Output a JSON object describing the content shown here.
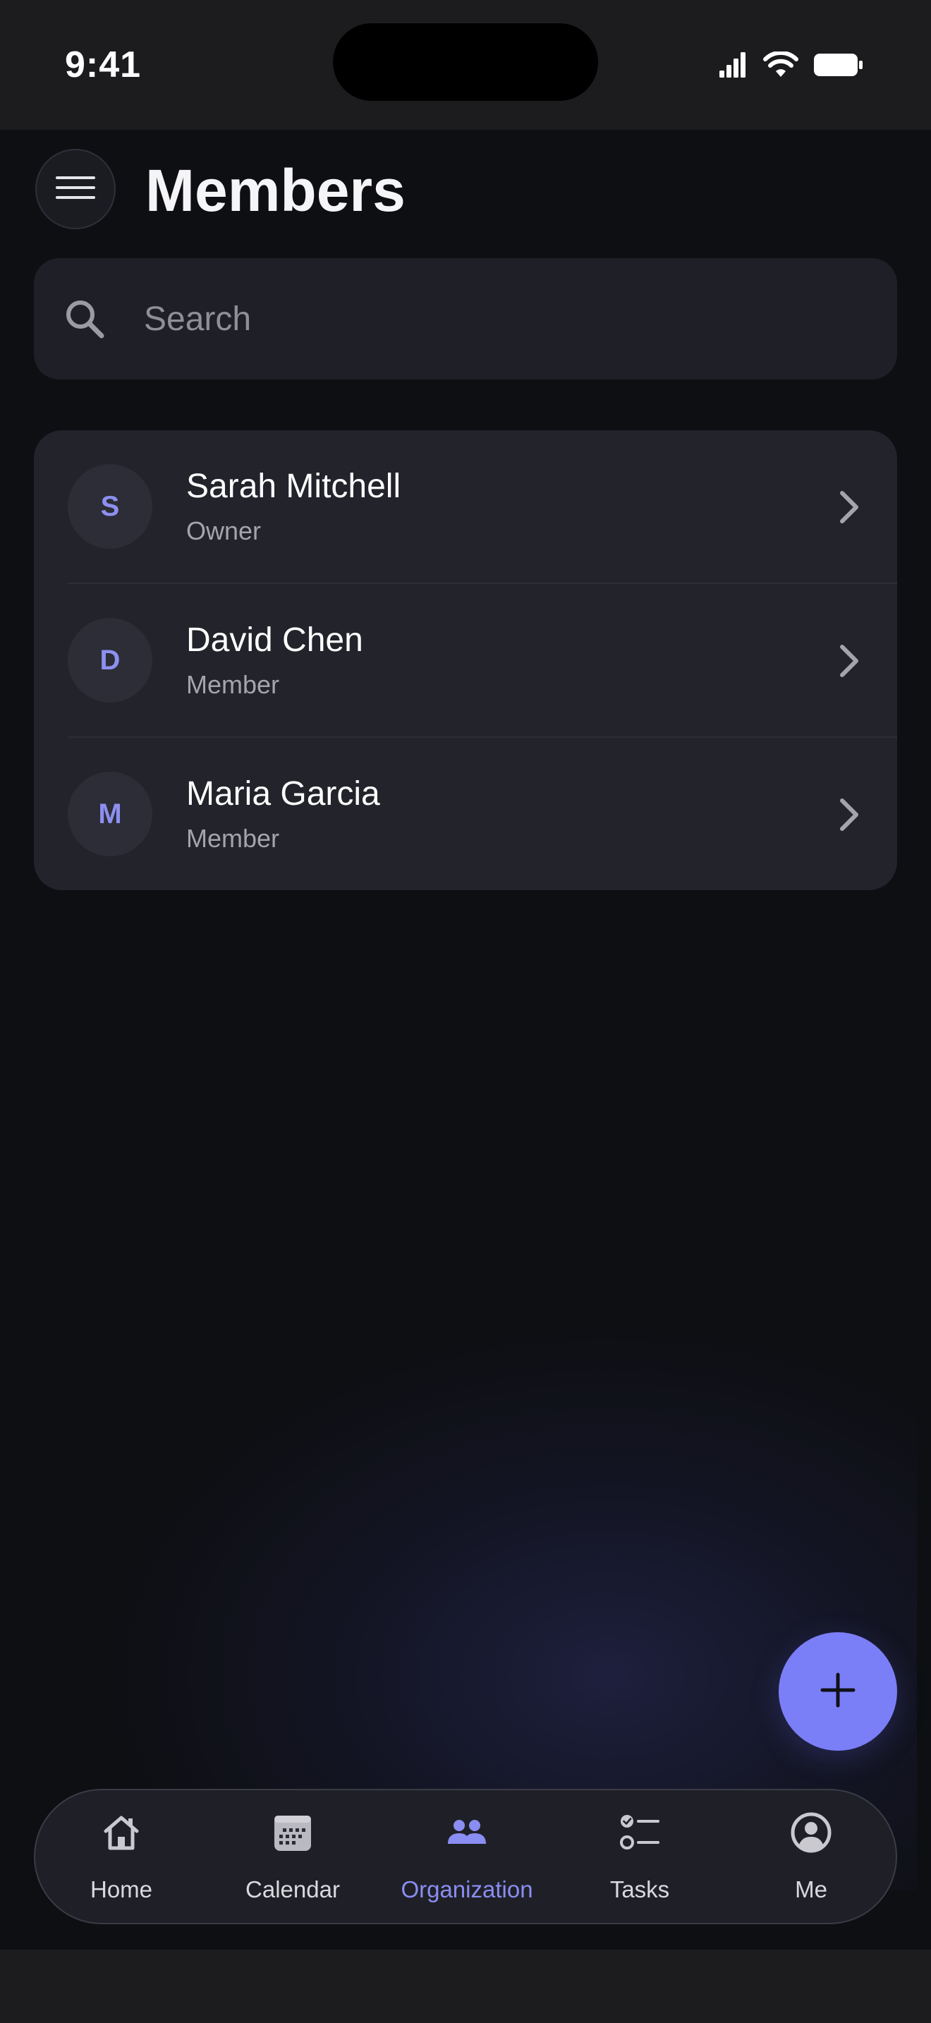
{
  "status_bar": {
    "time": "9:41",
    "icons": [
      "cellular-signal-icon",
      "wifi-icon",
      "battery-icon"
    ]
  },
  "header": {
    "menu_icon": "hamburger-menu-icon",
    "title": "Members"
  },
  "search": {
    "placeholder": "Search",
    "value": "",
    "icon": "search-icon"
  },
  "members": [
    {
      "initial": "S",
      "name": "Sarah Mitchell",
      "role": "Owner"
    },
    {
      "initial": "D",
      "name": "David Chen",
      "role": "Member"
    },
    {
      "initial": "M",
      "name": "Maria Garcia",
      "role": "Member"
    }
  ],
  "fab": {
    "icon": "plus-icon"
  },
  "tab_bar": {
    "active": "Organization",
    "tabs": [
      {
        "label": "Home",
        "icon": "home-icon"
      },
      {
        "label": "Calendar",
        "icon": "calendar-icon"
      },
      {
        "label": "Organization",
        "icon": "people-icon"
      },
      {
        "label": "Tasks",
        "icon": "checklist-icon"
      },
      {
        "label": "Me",
        "icon": "person-circle-icon"
      }
    ]
  },
  "colors": {
    "accent": "#7b7ff7",
    "background": "#0e0f13",
    "card": "#22232b",
    "text_secondary": "#a3a4ad"
  }
}
